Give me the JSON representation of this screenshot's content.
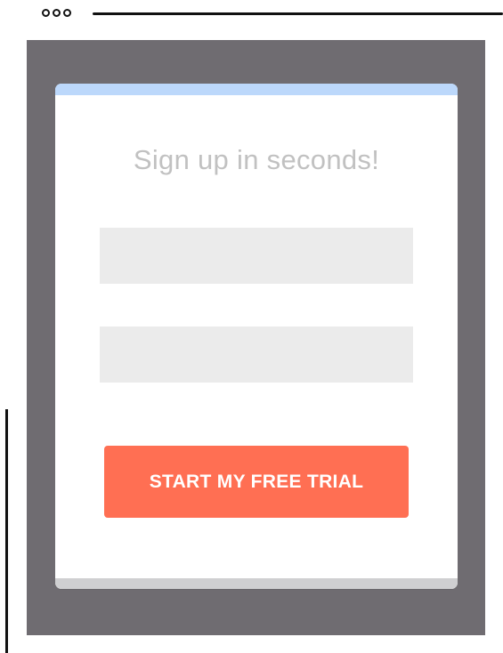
{
  "colors": {
    "backdrop": "#6f6c71",
    "card": "#ffffff",
    "card_top_accent": "#bcd8fb",
    "field_bg": "#ebebeb",
    "cta_bg": "#ff6f53",
    "cta_text": "#ffffff",
    "title_text": "#c1c1c1"
  },
  "signup": {
    "title": "Sign up in seconds!",
    "fields": [
      {
        "value": "",
        "placeholder": ""
      },
      {
        "value": "",
        "placeholder": ""
      }
    ],
    "cta_label": "START MY FREE TRIAL"
  }
}
